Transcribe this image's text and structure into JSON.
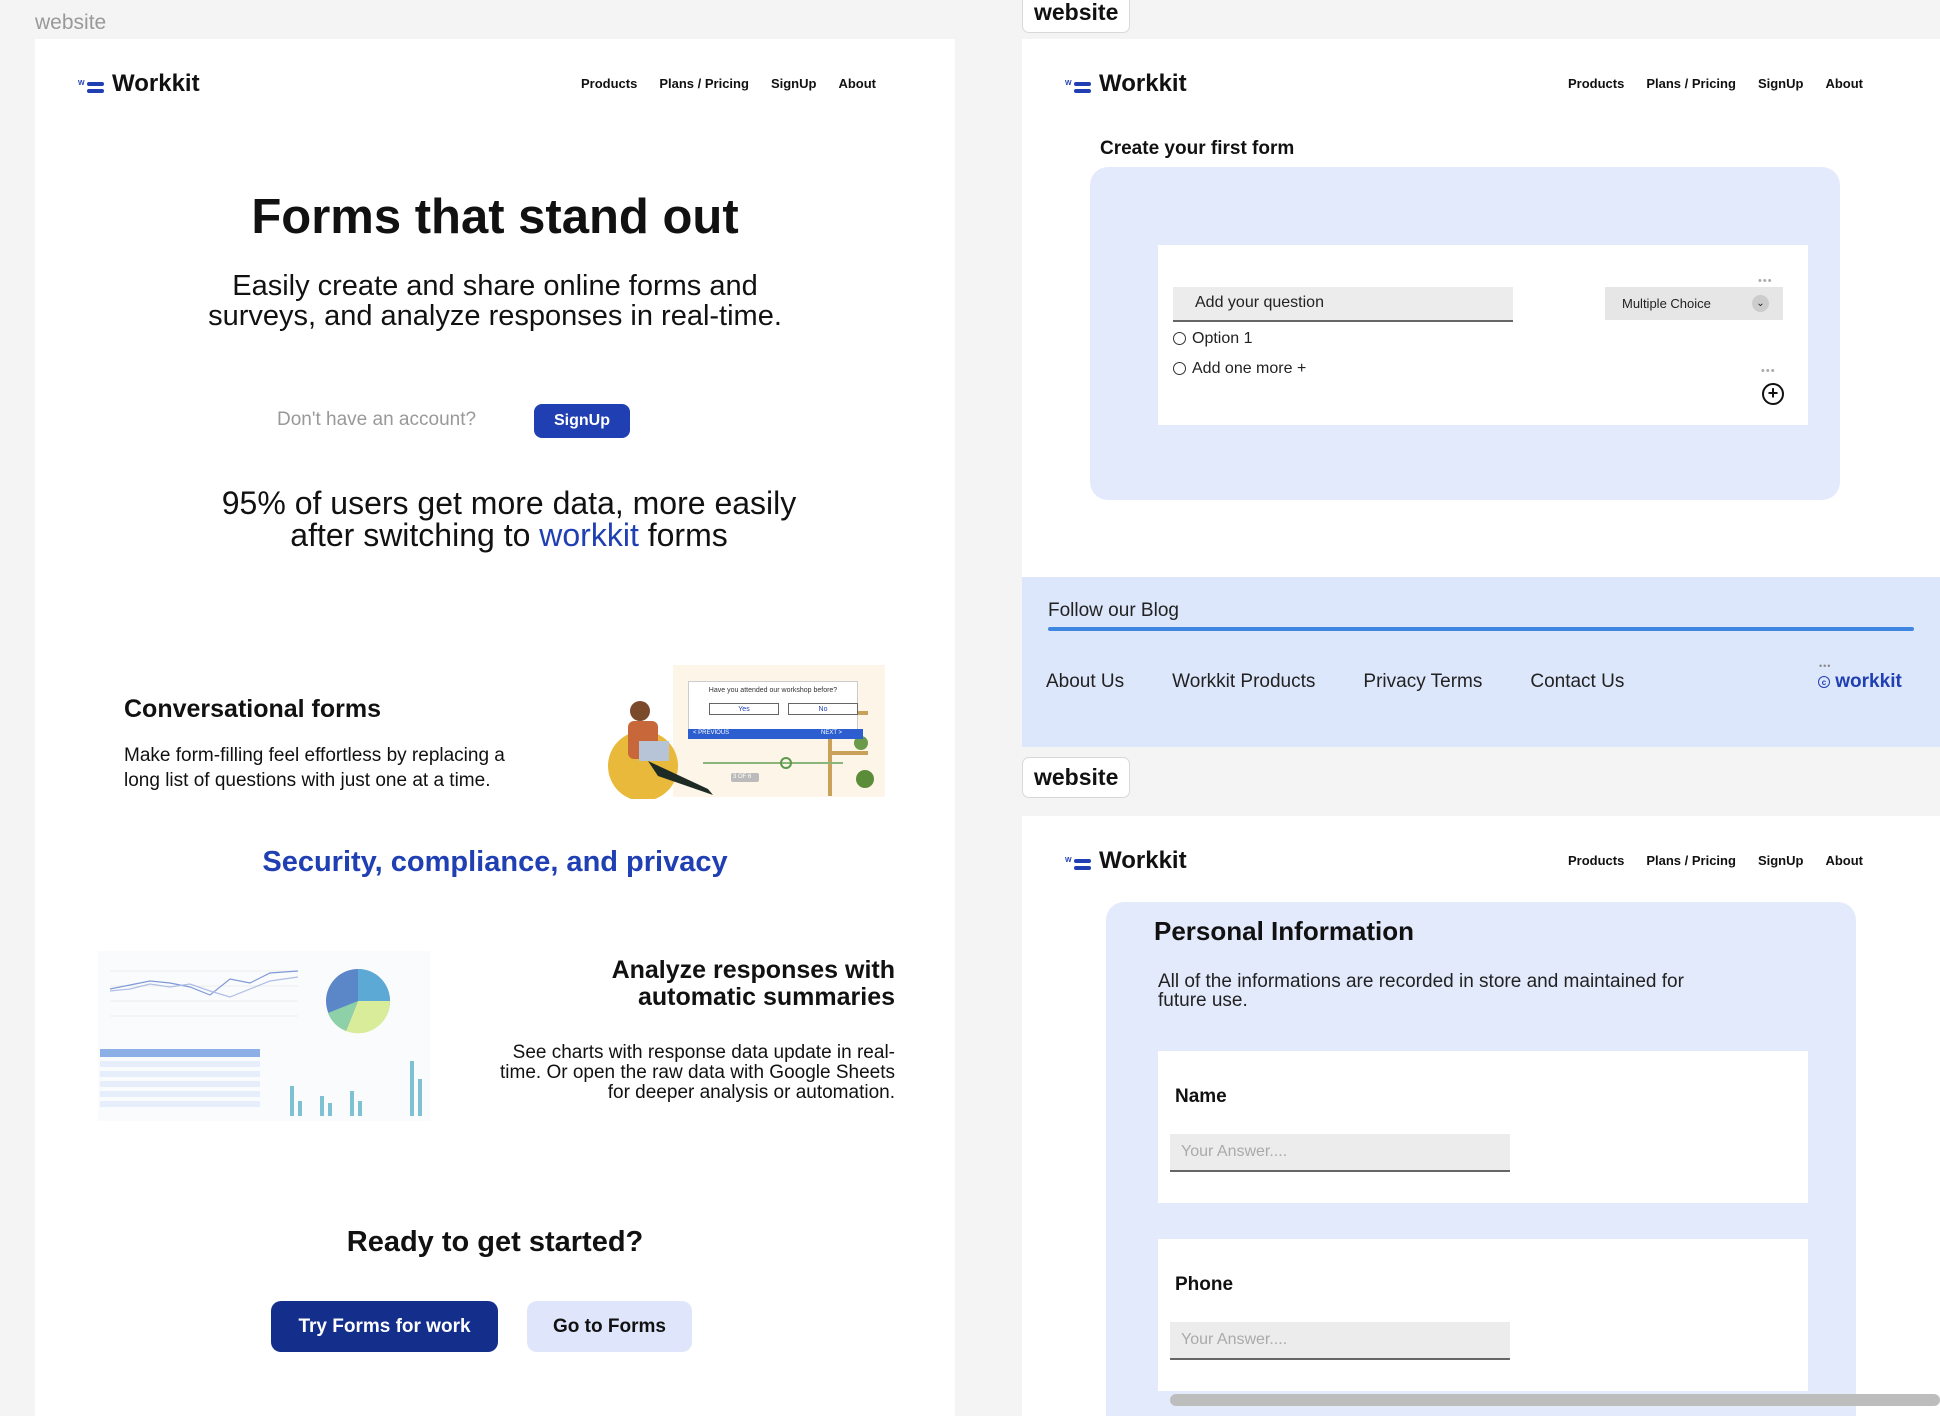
{
  "frames": {
    "label_main": "website",
    "label_top_right": "website",
    "label_bottom_right": "website"
  },
  "header": {
    "brand": "Workkit",
    "nav": [
      "Products",
      "Plans / Pricing",
      "SignUp",
      "About"
    ]
  },
  "landing": {
    "hero_title": "Forms that stand out",
    "hero_subtitle_line1": "Easily create and share online forms and",
    "hero_subtitle_line2": "surveys, and analyze responses in real-time.",
    "account_prompt": "Don't have an account?",
    "signup_button": "SignUp",
    "stat_line1": "95% of users get more data, more easily",
    "stat_line2_pre": "after switching to",
    "stat_brand": "workkit",
    "stat_line2_post": "forms",
    "feature1_title": "Conversational forms",
    "feature1_desc_line1": "Make form-filling feel effortless by replacing a",
    "feature1_desc_line2": "long list of questions with just one at a time.",
    "illustration": {
      "question": "Have you attended our workshop before?",
      "yes": "Yes",
      "no": "No",
      "previous": "< PREVIOUS",
      "next": "NEXT >",
      "step": "3 OF 6"
    },
    "security_heading": "Security, compliance, and privacy",
    "feature2_title_line1": "Analyze responses with",
    "feature2_title_line2": "automatic summaries",
    "feature2_desc_line1": "See charts with response data update in real-",
    "feature2_desc_line2": "time. Or open the raw data with Google Sheets",
    "feature2_desc_line3": "for deeper analysis or automation.",
    "cta_title": "Ready to get started?",
    "cta_primary": "Try Forms for work",
    "cta_secondary": "Go to Forms"
  },
  "builder": {
    "title": "Create your first form",
    "question_placeholder": "Add your question",
    "question_type": "Multiple Choice",
    "option1": "Option 1",
    "add_more": "Add one more +"
  },
  "footer": {
    "follow": "Follow our Blog",
    "links": [
      "About Us",
      "Workkit Products",
      "Privacy Terms",
      "Contact Us"
    ],
    "brand": "workkit"
  },
  "personal": {
    "title": "Personal Information",
    "desc_line1": "All of the informations are recorded in store and maintained for",
    "desc_line2": "future use.",
    "field1_label": "Name",
    "field1_placeholder": "Your Answer....",
    "field2_label": "Phone",
    "field2_placeholder": "Your Answer...."
  },
  "colors": {
    "accent": "#1f3fb3",
    "accent_light": "#e3eafc",
    "footer_bg": "#dde7fb"
  }
}
